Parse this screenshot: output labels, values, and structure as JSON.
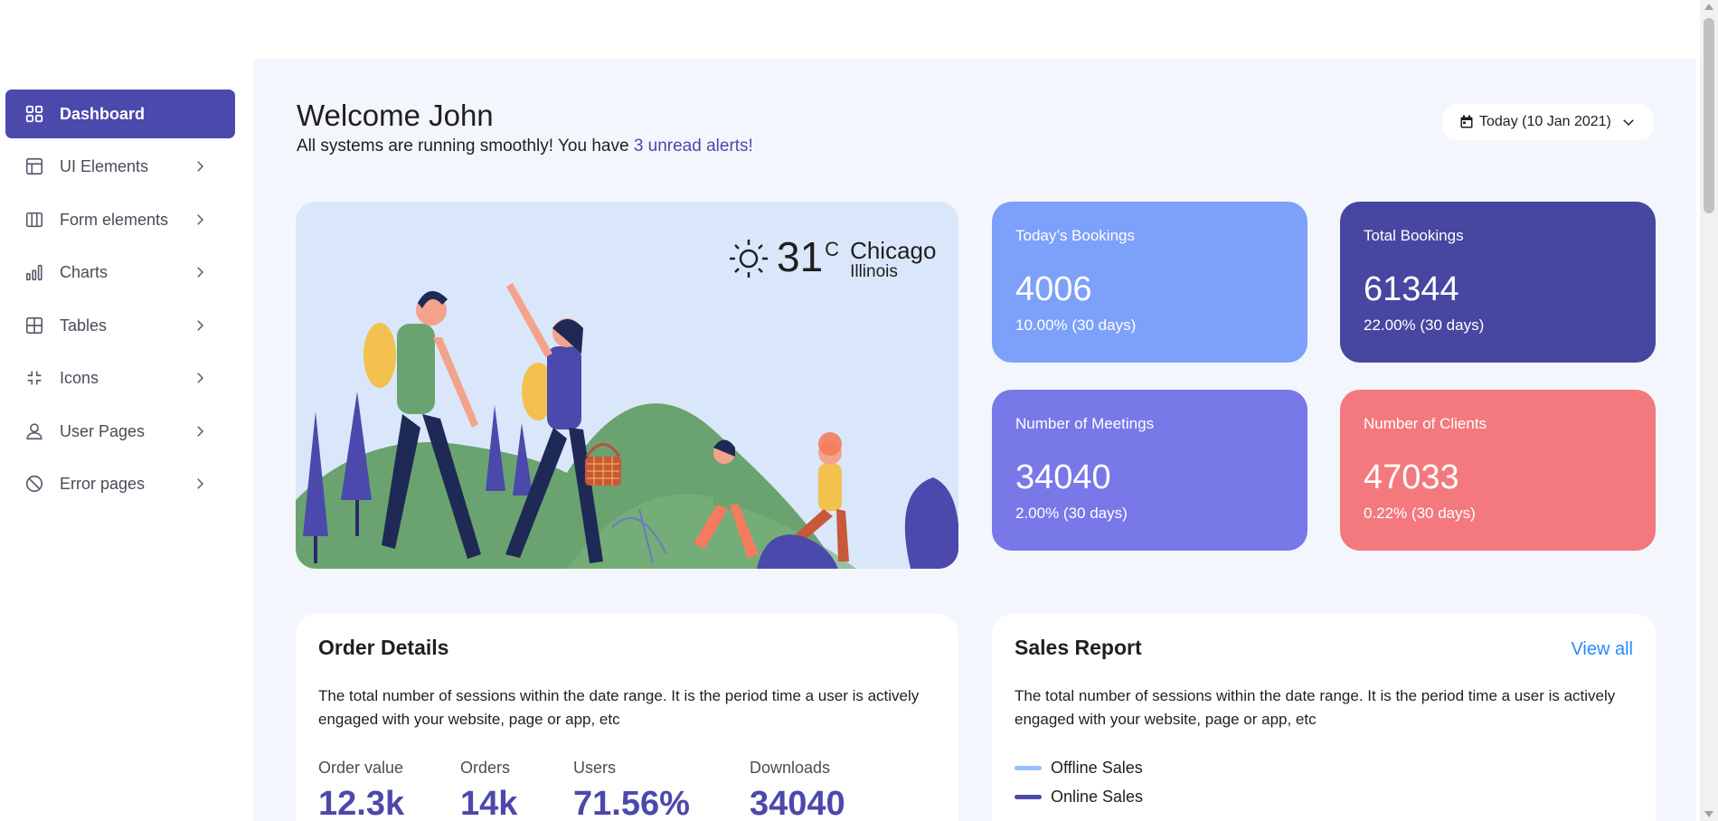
{
  "sidebar": {
    "items": [
      {
        "label": "Dashboard",
        "icon": "grid-icon",
        "active": true
      },
      {
        "label": "UI Elements",
        "icon": "layout-icon"
      },
      {
        "label": "Form elements",
        "icon": "columns-icon"
      },
      {
        "label": "Charts",
        "icon": "bar-chart-icon"
      },
      {
        "label": "Tables",
        "icon": "table-icon"
      },
      {
        "label": "Icons",
        "icon": "collapse-icon"
      },
      {
        "label": "User Pages",
        "icon": "user-icon"
      },
      {
        "label": "Error pages",
        "icon": "ban-icon"
      }
    ]
  },
  "header": {
    "welcome": "Welcome John",
    "subtitle_prefix": "All systems are running smoothly! You have ",
    "alerts_link": "3 unread alerts!",
    "date_button": "Today (10 Jan 2021)"
  },
  "weather": {
    "temperature": "31",
    "unit": "C",
    "city": "Chicago",
    "state": "Illinois"
  },
  "stats": [
    {
      "title": "Today’s Bookings",
      "value": "4006",
      "change": "10.00% (30 days)",
      "color": "#7da0fa"
    },
    {
      "title": "Total Bookings",
      "value": "61344",
      "change": "22.00% (30 days)",
      "color": "#4747a1"
    },
    {
      "title": "Number of Meetings",
      "value": "34040",
      "change": "2.00% (30 days)",
      "color": "#7978e9"
    },
    {
      "title": "Number of Clients",
      "value": "47033",
      "change": "0.22% (30 days)",
      "color": "#f3797e"
    }
  ],
  "order_details": {
    "title": "Order Details",
    "description": "The total number of sessions within the date range. It is the period time a user is actively engaged with your website, page or app, etc",
    "metrics": [
      {
        "label": "Order value",
        "value": "12.3k"
      },
      {
        "label": "Orders",
        "value": "14k"
      },
      {
        "label": "Users",
        "value": "71.56%"
      },
      {
        "label": "Downloads",
        "value": "34040"
      }
    ]
  },
  "sales_report": {
    "title": "Sales Report",
    "view_all": "View all",
    "description": "The total number of sessions within the date range. It is the period time a user is actively engaged with your website, page or app, etc",
    "legend": [
      {
        "label": "Offline Sales",
        "color": "#98bdff"
      },
      {
        "label": "Online Sales",
        "color": "#4b49ac"
      }
    ]
  },
  "colors": {
    "accent": "#4b49ac",
    "link": "#248afd",
    "background": "#f4f6fd"
  }
}
